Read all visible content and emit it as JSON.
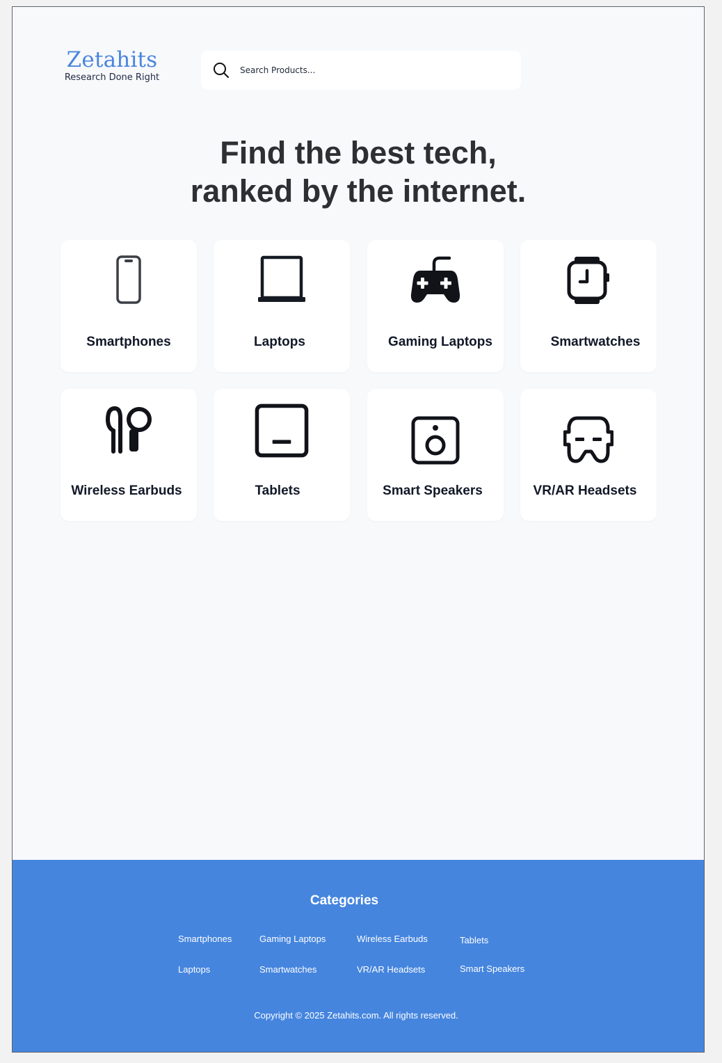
{
  "brand": {
    "name": "Zetahits",
    "tagline": "Research Done Right",
    "accent": "#4a86dc"
  },
  "search": {
    "placeholder": "Search Products..."
  },
  "hero": {
    "line1": "Find the best tech,",
    "line2": "ranked by the internet."
  },
  "categories": [
    {
      "label": "Smartphones",
      "icon": "smartphone-icon"
    },
    {
      "label": "Laptops",
      "icon": "laptop-icon"
    },
    {
      "label": "Gaming Laptops",
      "icon": "gamepad-icon"
    },
    {
      "label": "Smartwatches",
      "icon": "smartwatch-icon"
    },
    {
      "label": "Wireless Earbuds",
      "icon": "earbuds-icon"
    },
    {
      "label": "Tablets",
      "icon": "tablet-icon"
    },
    {
      "label": "Smart Speakers",
      "icon": "speaker-icon"
    },
    {
      "label": "VR/AR Headsets",
      "icon": "vr-headset-icon"
    }
  ],
  "footer": {
    "title": "Categories",
    "links": [
      "Smartphones",
      "Gaming Laptops",
      "Wireless Earbuds",
      "Tablets",
      "Laptops",
      "Smartwatches",
      "VR/AR Headsets",
      "Smart Speakers"
    ],
    "copyright": "Copyright © 2025 Zetahits.com. All rights reserved.",
    "background": "#4585de"
  }
}
